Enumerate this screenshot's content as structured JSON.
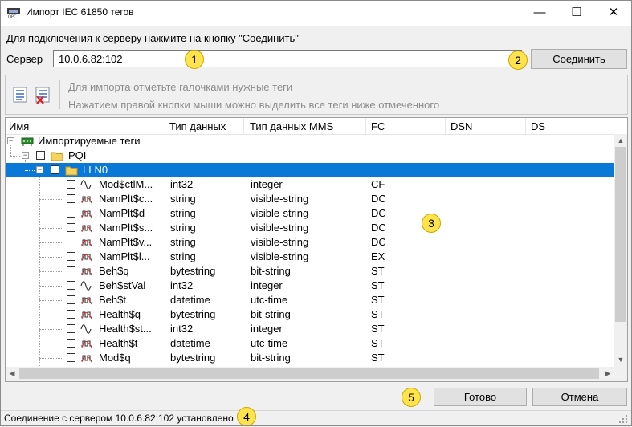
{
  "window": {
    "title": "Импорт IEC 61850 тегов",
    "minimize_glyph": "—",
    "maximize_glyph": "☐",
    "close_glyph": "✕"
  },
  "hint": "Для подключения к серверу нажмите на кнопку \"Соединить\"",
  "server": {
    "label": "Сервер",
    "value": "10.0.6.82:102",
    "connect_label": "Соединить"
  },
  "toolbar": {
    "hint1": "Для импорта отметьте галочками нужные теги",
    "hint2": "Нажатием правой кнопки мыши можно выделить все теги ниже отмеченного"
  },
  "columns": [
    "Имя",
    "Тип данных",
    "Тип данных MMS",
    "FC",
    "DSN",
    "DS"
  ],
  "tree": {
    "root": "Импортируемые теги",
    "device": "PQI",
    "node": "LLN0",
    "tags": [
      {
        "name": "Mod$ctlM...",
        "type": "int32",
        "mms": "integer",
        "fc": "CF",
        "icon": "sine-wave-icon"
      },
      {
        "name": "NamPlt$c...",
        "type": "string",
        "mms": "visible-string",
        "fc": "DC",
        "icon": "square-wave-icon"
      },
      {
        "name": "NamPlt$d",
        "type": "string",
        "mms": "visible-string",
        "fc": "DC",
        "icon": "square-wave-icon"
      },
      {
        "name": "NamPlt$s...",
        "type": "string",
        "mms": "visible-string",
        "fc": "DC",
        "icon": "square-wave-icon"
      },
      {
        "name": "NamPlt$v...",
        "type": "string",
        "mms": "visible-string",
        "fc": "DC",
        "icon": "square-wave-icon"
      },
      {
        "name": "NamPlt$l...",
        "type": "string",
        "mms": "visible-string",
        "fc": "EX",
        "icon": "square-wave-icon"
      },
      {
        "name": "Beh$q",
        "type": "bytestring",
        "mms": "bit-string",
        "fc": "ST",
        "icon": "square-wave-icon"
      },
      {
        "name": "Beh$stVal",
        "type": "int32",
        "mms": "integer",
        "fc": "ST",
        "icon": "sine-wave-icon"
      },
      {
        "name": "Beh$t",
        "type": "datetime",
        "mms": "utc-time",
        "fc": "ST",
        "icon": "square-wave-icon"
      },
      {
        "name": "Health$q",
        "type": "bytestring",
        "mms": "bit-string",
        "fc": "ST",
        "icon": "square-wave-icon"
      },
      {
        "name": "Health$st...",
        "type": "int32",
        "mms": "integer",
        "fc": "ST",
        "icon": "sine-wave-icon"
      },
      {
        "name": "Health$t",
        "type": "datetime",
        "mms": "utc-time",
        "fc": "ST",
        "icon": "square-wave-icon"
      },
      {
        "name": "Mod$q",
        "type": "bytestring",
        "mms": "bit-string",
        "fc": "ST",
        "icon": "square-wave-icon"
      }
    ]
  },
  "buttons": {
    "ok": "Готово",
    "cancel": "Отмена"
  },
  "status": "Соединение с сервером 10.0.6.82:102 установлено",
  "markers": [
    "1",
    "2",
    "3",
    "4",
    "5"
  ],
  "colors": {
    "selection": "#0a78d7",
    "marker": "#ffe34d"
  }
}
